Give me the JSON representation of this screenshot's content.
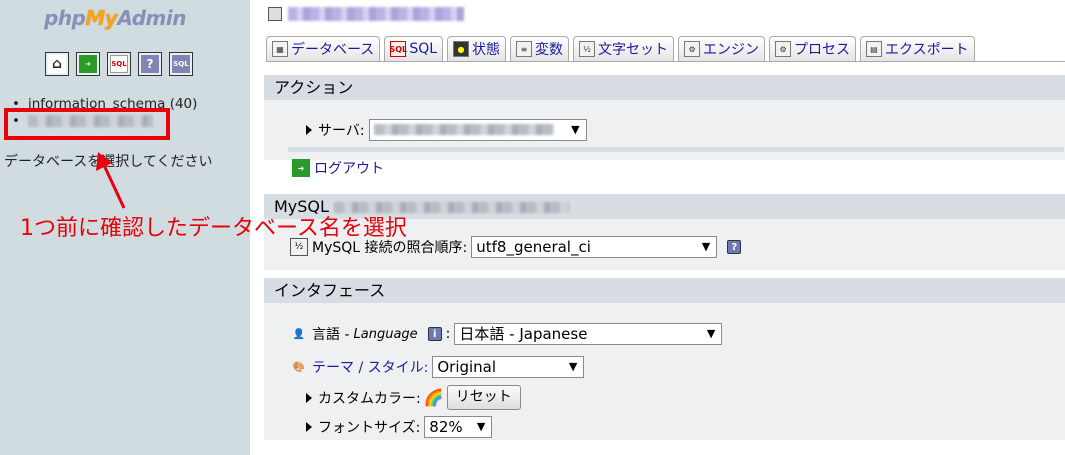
{
  "left": {
    "logo": {
      "php": "php",
      "my": "My",
      "admin": "Admin"
    },
    "nav_icons": [
      "home-icon",
      "exit-icon",
      "sql-icon",
      "help-icon",
      "docs-icon"
    ],
    "databases": [
      "information_schema (40)"
    ],
    "select_prompt": "データベースを選択してください"
  },
  "annotation": {
    "text": "1つ前に確認したデータベース名を選択",
    "color": "#e8000a"
  },
  "tabs": [
    {
      "label": "データベース",
      "icon": "database-icon"
    },
    {
      "label": "SQL",
      "icon": "sql-icon"
    },
    {
      "label": "状態",
      "icon": "status-icon"
    },
    {
      "label": "変数",
      "icon": "variables-icon"
    },
    {
      "label": "文字セット",
      "icon": "charset-icon"
    },
    {
      "label": "エンジン",
      "icon": "engine-icon"
    },
    {
      "label": "プロセス",
      "icon": "process-icon"
    },
    {
      "label": "エクスポート",
      "icon": "export-icon"
    }
  ],
  "actions": {
    "heading": "アクション",
    "server_label": "サーバ:",
    "logout_label": "ログアウト"
  },
  "mysql": {
    "heading": "MySQL",
    "collation_label": "MySQL 接続の照合順序:",
    "collation_value": "utf8_general_ci",
    "help": "?"
  },
  "interface": {
    "heading": "インタフェース",
    "language_label": "言語 - ",
    "language_en": "Language",
    "info": "i",
    "language_value": "日本語 - Japanese",
    "theme_label": "テーマ / スタイル:",
    "theme_value": "Original",
    "custom_color_label": "カスタムカラー:",
    "reset_label": "リセット",
    "fontsize_label": "フォントサイズ:",
    "fontsize_value": "82%"
  },
  "colors": {
    "accent_red": "#e8000a",
    "link_blue": "#1a1aa0",
    "left_bg": "#d0dce0"
  }
}
